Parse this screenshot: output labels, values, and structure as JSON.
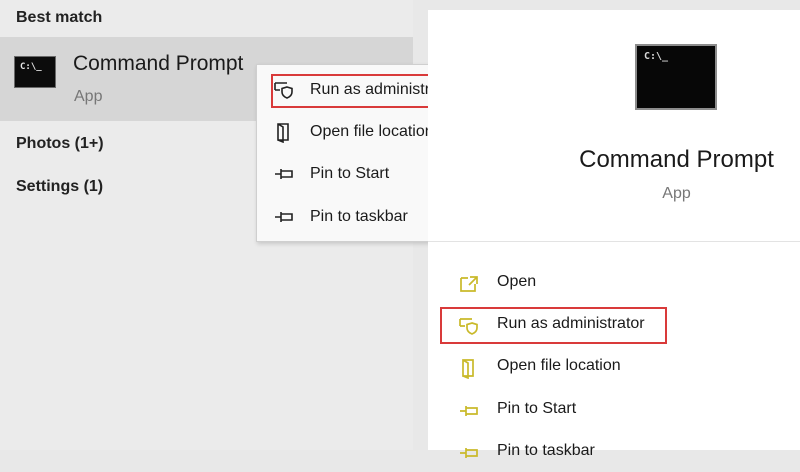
{
  "left_panel": {
    "best_match_heading": "Best match",
    "best_match": {
      "name": "Command Prompt",
      "type": "App",
      "icon": "command-prompt-icon",
      "icon_text": "C:\\_"
    },
    "categories": [
      {
        "label": "Photos (1+)"
      },
      {
        "label": "Settings (1)"
      }
    ]
  },
  "context_menu": {
    "items": [
      {
        "label": "Run as administrator",
        "icon": "admin-shield-icon",
        "highlighted": true
      },
      {
        "label": "Open file location",
        "icon": "folder-location-icon"
      },
      {
        "label": "Pin to Start",
        "icon": "pin-icon"
      },
      {
        "label": "Pin to taskbar",
        "icon": "pin-icon"
      }
    ]
  },
  "right_panel": {
    "title": "Command Prompt",
    "subtitle": "App",
    "icon_text": "C:\\_",
    "actions": [
      {
        "label": "Open",
        "icon": "open-icon"
      },
      {
        "label": "Run as administrator",
        "icon": "admin-shield-icon",
        "highlighted": true
      },
      {
        "label": "Open file location",
        "icon": "folder-location-icon"
      },
      {
        "label": "Pin to Start",
        "icon": "pin-icon"
      },
      {
        "label": "Pin to taskbar",
        "icon": "pin-icon"
      }
    ]
  },
  "colors": {
    "highlight_border": "#d93a3a",
    "action_icon": "#c9b92a",
    "selected_item_bg": "#d6d6d6"
  }
}
